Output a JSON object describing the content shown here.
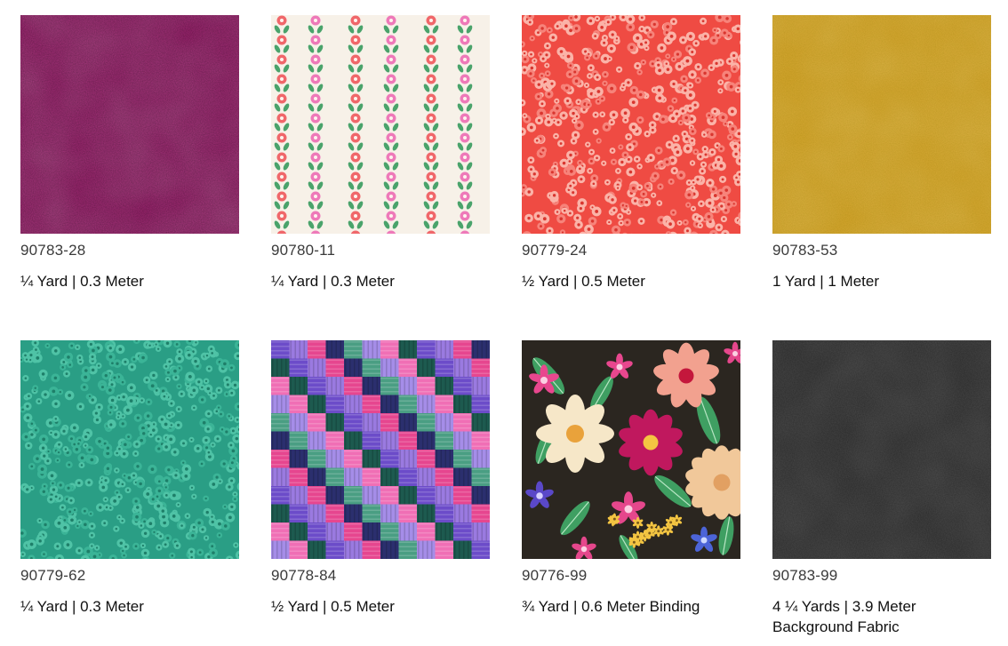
{
  "fabrics": [
    {
      "code": "90783-28",
      "amount": "¼ Yard | 0.3 Meter",
      "pattern": "texture",
      "color": "#9c1f6d"
    },
    {
      "code": "90780-11",
      "amount": "¼ Yard | 0.3 Meter",
      "pattern": "floral-stripe",
      "color": "#f7f1e8"
    },
    {
      "code": "90779-24",
      "amount": "½ Yard | 0.5 Meter",
      "pattern": "mini-dots",
      "color": "#ef4b43"
    },
    {
      "code": "90783-53",
      "amount": "1 Yard | 1 Meter",
      "pattern": "texture",
      "color": "#d2a22a"
    },
    {
      "code": "90779-62",
      "amount": "¼ Yard | 0.3 Meter",
      "pattern": "mini-dots",
      "color": "#2a9e85"
    },
    {
      "code": "90778-84",
      "amount": "½ Yard | 0.5 Meter",
      "pattern": "woven-plaid",
      "color": "#7a4fc8"
    },
    {
      "code": "90776-99",
      "amount": "¾ Yard | 0.6 Meter Binding",
      "pattern": "large-floral",
      "color": "#2b2620"
    },
    {
      "code": "90783-99",
      "amount": "4 ¼ Yards | 3.9 Meter",
      "amount_line2": "Background Fabric",
      "pattern": "texture",
      "color": "#262626"
    }
  ]
}
